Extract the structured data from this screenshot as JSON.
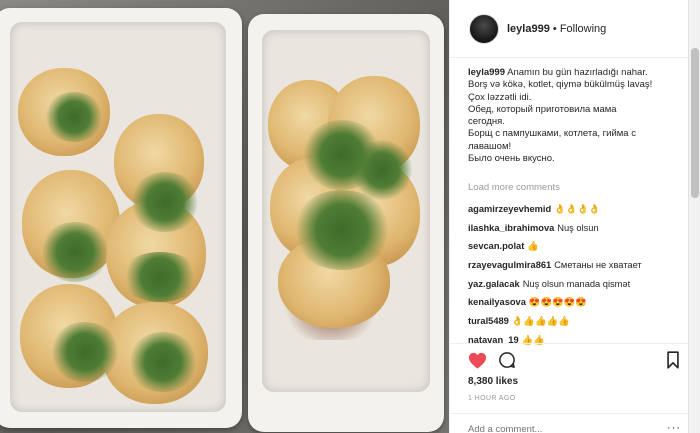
{
  "header": {
    "username": "leyla999",
    "separator": "•",
    "follow_status": "Following"
  },
  "caption": {
    "username": "leyla999",
    "lines": [
      "Anamın bu gün hazırladığı nahar.",
      "Borş və kökə, kotlet, qiymə bükülmüş lavaş!",
      "Çox ləzzətli idi.",
      "Обед, который приготовила мама",
      "сегодня.",
      "Борщ с пампушками, котлета, гийма с",
      "лавашом!",
      "Было очень вкусно."
    ]
  },
  "load_more": "Load more comments",
  "comments": [
    {
      "user": "agamirzeyevhemid",
      "text": "👌👌👌👌"
    },
    {
      "user": "ilashka_ibrahimova",
      "text": "Nuş olsun"
    },
    {
      "user": "sevcan.polat",
      "text": "👍"
    },
    {
      "user": "rzayevagulmira861",
      "text": "Сметаны не хватает"
    },
    {
      "user": "yaz.galacak",
      "text": "Nuş olsun manada qismət"
    },
    {
      "user": "kenailyasova",
      "text": "😍😍😍😍😍"
    },
    {
      "user": "tural5489",
      "text": "👌👍👍👍👍"
    },
    {
      "user": "natavan_19",
      "text": "👍👍"
    }
  ],
  "actions": {
    "like_icon": "heart-icon",
    "comment_icon": "comment-bubble-icon",
    "save_icon": "bookmark-icon",
    "like_color": "#ed4956"
  },
  "likes": "8,380 likes",
  "timestamp": "1 HOUR AGO",
  "add_comment": {
    "placeholder": "Add a comment...",
    "more": "···"
  }
}
